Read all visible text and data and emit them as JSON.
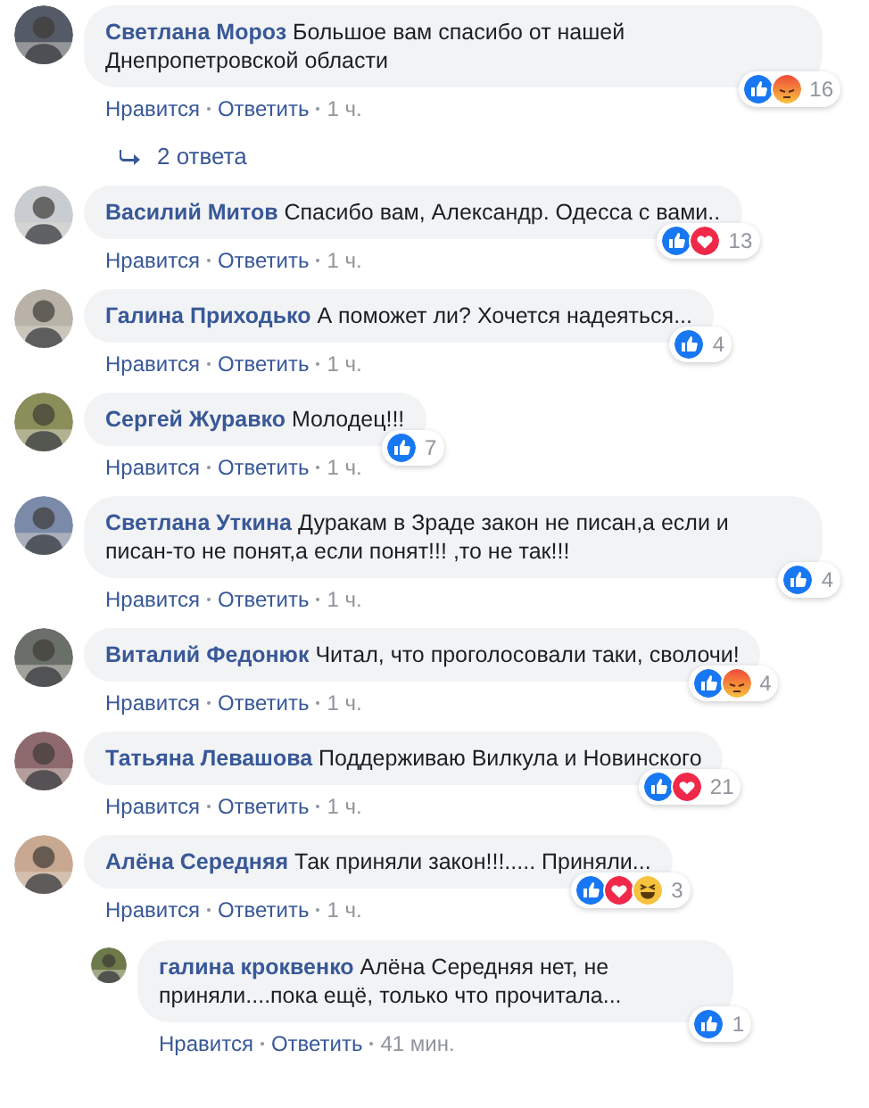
{
  "comments": [
    {
      "author": "Светлана Мороз",
      "text": "Большое вам спасибо от нашей Днепропетровской области",
      "reactions": [
        {
          "kind": "like"
        },
        {
          "kind": "angry"
        }
      ],
      "reaction_count": "16",
      "actions": [
        "Нравится",
        "Ответить"
      ],
      "time": "1 ч.",
      "replies_link": "2 ответа"
    },
    {
      "author": "Василий Митов",
      "text": "Спасибо вам, Александр. Одесса с вами..",
      "reactions": [
        {
          "kind": "like"
        },
        {
          "kind": "love"
        }
      ],
      "reaction_count": "13",
      "actions": [
        "Нравится",
        "Ответить"
      ],
      "time": "1 ч."
    },
    {
      "author": "Галина Приходько",
      "text": "А поможет ли? Хочется надеяться...",
      "reactions": [
        {
          "kind": "like"
        }
      ],
      "reaction_count": "4",
      "actions": [
        "Нравится",
        "Ответить"
      ],
      "time": "1 ч."
    },
    {
      "author": "Сергей Журавко",
      "text": "Молодец!!!",
      "reactions": [
        {
          "kind": "like"
        }
      ],
      "reaction_count": "7",
      "actions": [
        "Нравится",
        "Ответить"
      ],
      "time": "1 ч."
    },
    {
      "author": "Светлана Уткина",
      "text": "Дуракам в Зраде закон не писан,а если и писан-то не понят,а если понят!!! ,то не так!!!",
      "reactions": [
        {
          "kind": "like"
        }
      ],
      "reaction_count": "4",
      "actions": [
        "Нравится",
        "Ответить"
      ],
      "time": "1 ч."
    },
    {
      "author": "Виталий Федонюк",
      "text": "Читал, что проголосовали таки, сволочи!",
      "reactions": [
        {
          "kind": "like"
        },
        {
          "kind": "angry"
        }
      ],
      "reaction_count": "4",
      "actions": [
        "Нравится",
        "Ответить"
      ],
      "time": "1 ч."
    },
    {
      "author": "Татьяна Левашова",
      "text": "Поддерживаю Вилкула и Новинского",
      "reactions": [
        {
          "kind": "like"
        },
        {
          "kind": "love"
        }
      ],
      "reaction_count": "21",
      "actions": [
        "Нравится",
        "Ответить"
      ],
      "time": "1 ч."
    },
    {
      "author": "Алёна Середняя",
      "text": "Так приняли закон!!!..... Приняли...",
      "reactions": [
        {
          "kind": "like"
        },
        {
          "kind": "love"
        },
        {
          "kind": "haha"
        }
      ],
      "reaction_count": "3",
      "actions": [
        "Нравится",
        "Ответить"
      ],
      "time": "1 ч.",
      "children": [
        {
          "author": "галина кроквенко",
          "text": "Алёна Середняя нет, не приняли....пока ещё, только что прочитала...",
          "reactions": [
            {
              "kind": "like"
            }
          ],
          "reaction_count": "1",
          "actions": [
            "Нравится",
            "Ответить"
          ],
          "time": "41 мин."
        }
      ]
    }
  ]
}
